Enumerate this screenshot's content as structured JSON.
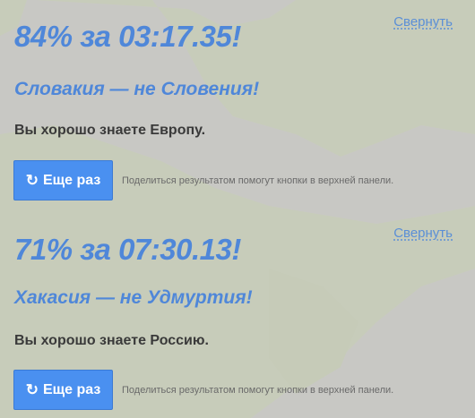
{
  "results": [
    {
      "collapse_label": "Свернуть",
      "score": "84% за 03:17.35!",
      "mistake": "Словакия — не Словения!",
      "praise": "Вы хорошо знаете Европу.",
      "retry_icon": "refresh-icon",
      "retry_glyph": "↻",
      "retry_label": "Еще раз",
      "share_hint": "Поделиться результатом помогут кнопки в верхней панели."
    },
    {
      "collapse_label": "Свернуть",
      "score": "71% за 07:30.13!",
      "mistake": "Хакасия — не Удмуртия!",
      "praise": "Вы хорошо знаете Россию.",
      "retry_icon": "refresh-icon",
      "retry_glyph": "↻",
      "retry_label": "Еще раз",
      "share_hint": "Поделиться результатом помогут кнопки в верхней панели."
    }
  ],
  "colors": {
    "accent": "#4f87d9",
    "button": "#4a90f0",
    "link": "#5b8fd6",
    "map_land": "#c8d7a8",
    "map_sea": "#c3c3bf"
  }
}
